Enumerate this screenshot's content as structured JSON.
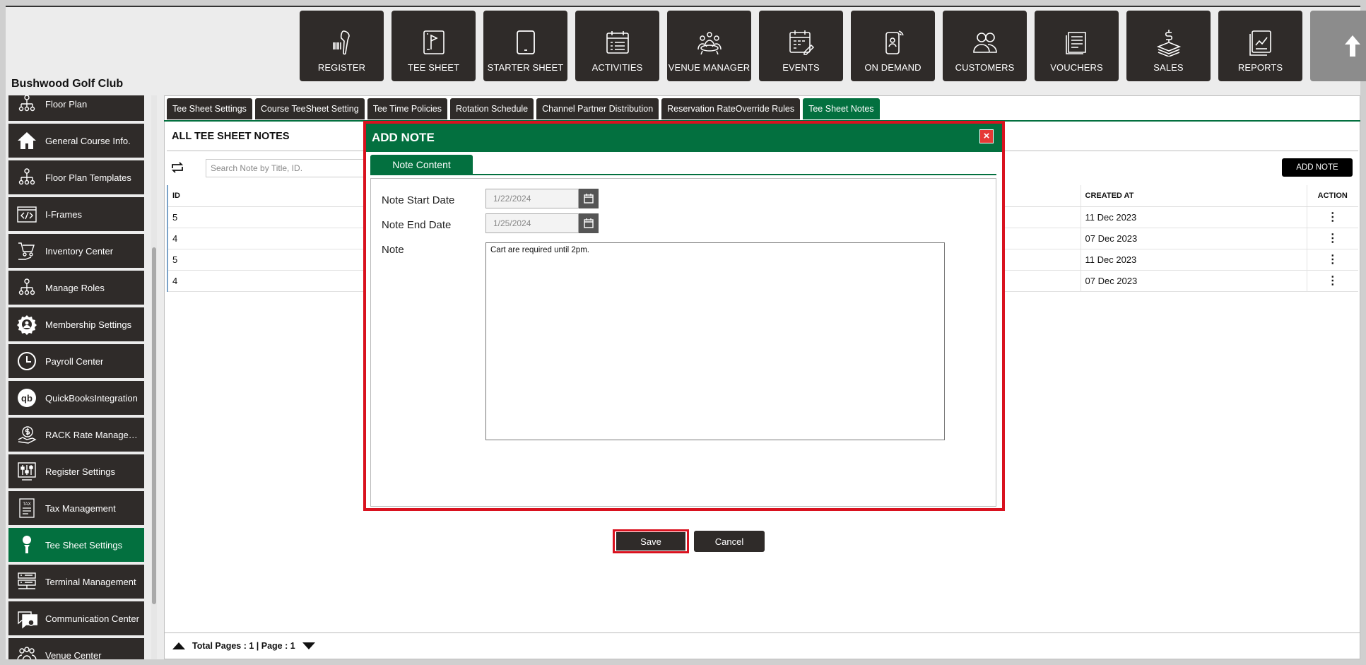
{
  "club_name": "Bushwood Golf Club",
  "topnav": [
    {
      "label": "REGISTER",
      "icon": "barcode-scanner-icon"
    },
    {
      "label": "TEE SHEET",
      "icon": "flag-sheet-icon"
    },
    {
      "label": "STARTER SHEET",
      "icon": "tablet-icon"
    },
    {
      "label": "ACTIVITIES",
      "icon": "calendar-list-icon"
    },
    {
      "label": "VENUE MANAGER",
      "icon": "meeting-table-icon"
    },
    {
      "label": "EVENTS",
      "icon": "calendar-edit-icon"
    },
    {
      "label": "ON DEMAND",
      "icon": "mobile-user-icon"
    },
    {
      "label": "CUSTOMERS",
      "icon": "users-icon"
    },
    {
      "label": "VOUCHERS",
      "icon": "receipt-icon"
    },
    {
      "label": "SALES",
      "icon": "money-icon"
    },
    {
      "label": "REPORTS",
      "icon": "report-chart-icon"
    }
  ],
  "sidebar": {
    "items": [
      {
        "label": "Floor Plan",
        "icon": "org-chart-icon"
      },
      {
        "label": "General Course Info.",
        "icon": "home-icon"
      },
      {
        "label": "Floor Plan Templates",
        "icon": "org-chart-icon"
      },
      {
        "label": "I-Frames",
        "icon": "code-window-icon"
      },
      {
        "label": "Inventory Center",
        "icon": "cart-hand-icon"
      },
      {
        "label": "Manage Roles",
        "icon": "org-chart-icon"
      },
      {
        "label": "Membership Settings",
        "icon": "gear-user-icon"
      },
      {
        "label": "Payroll Center",
        "icon": "clock-icon"
      },
      {
        "label": "QuickBooksIntegration",
        "icon": "quickbooks-icon"
      },
      {
        "label": "RACK Rate Manageme...",
        "icon": "dollar-hand-icon"
      },
      {
        "label": "Register Settings",
        "icon": "sliders-icon"
      },
      {
        "label": "Tax Management",
        "icon": "tax-doc-icon"
      },
      {
        "label": "Tee Sheet Settings",
        "icon": "golf-tee-icon",
        "active": true
      },
      {
        "label": "Terminal Management",
        "icon": "terminal-list-icon"
      },
      {
        "label": "Communication Center",
        "icon": "chat-cards-icon"
      },
      {
        "label": "Venue Center",
        "icon": "people-group-icon"
      }
    ]
  },
  "tabs": [
    {
      "label": "Tee Sheet Settings"
    },
    {
      "label": "Course TeeSheet Setting"
    },
    {
      "label": "Tee Time Policies"
    },
    {
      "label": "Rotation Schedule"
    },
    {
      "label": "Channel Partner Distribution"
    },
    {
      "label": "Reservation RateOverride Rules"
    },
    {
      "label": "Tee Sheet Notes",
      "active": true
    }
  ],
  "section_title": "ALL TEE SHEET NOTES",
  "search": {
    "placeholder": "Search Note by Title, ID.",
    "value": ""
  },
  "add_note_label": "ADD NOTE",
  "table": {
    "headers": {
      "id": "ID",
      "created": "CREATED AT",
      "action": "ACTION"
    },
    "rows": [
      {
        "id": "5",
        "created": "11 Dec 2023",
        "action": "⋮"
      },
      {
        "id": "4",
        "created": "07 Dec 2023",
        "action": "⋮"
      },
      {
        "id": "5",
        "created": "11 Dec 2023",
        "action": "⋮"
      },
      {
        "id": "4",
        "created": "07 Dec 2023",
        "action": "⋮"
      }
    ]
  },
  "pager": {
    "text": "Total Pages : 1 | Page : 1"
  },
  "modal": {
    "title": "ADD NOTE",
    "close": "×",
    "tab": "Note Content",
    "start_label": "Note Start Date",
    "start_value": "1/22/2024",
    "end_label": "Note End Date",
    "end_value": "1/25/2024",
    "note_label": "Note",
    "note_value": "Cart are required until 2pm.",
    "save": "Save",
    "cancel": "Cancel"
  },
  "colors": {
    "green": "#03703f",
    "dark": "#2f2b29",
    "red": "#d9121f"
  }
}
